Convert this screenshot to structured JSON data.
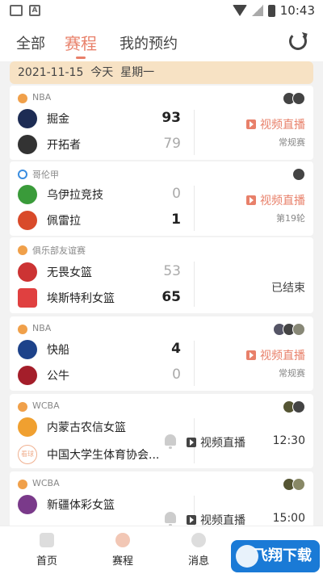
{
  "status": {
    "time": "10:43"
  },
  "nav": {
    "tabs": [
      "全部",
      "赛程",
      "我的预约"
    ]
  },
  "date_header": "2021-11-15  今天  星期一",
  "matches": [
    {
      "league": "NBA",
      "league_kind": "basketball",
      "home": "掘金",
      "away": "开拓者",
      "home_score": "93",
      "away_score": "79",
      "action": "视频直播",
      "stage": "常规赛"
    },
    {
      "league": "哥伦甲",
      "league_kind": "football",
      "home": "乌伊拉竞技",
      "away": "佩雷拉",
      "home_score": "0",
      "away_score": "1",
      "action": "视频直播",
      "stage": "第19轮"
    },
    {
      "league": "俱乐部友谊赛",
      "league_kind": "basketball",
      "home": "无畏女篮",
      "away": "埃斯特利女篮",
      "home_score": "53",
      "away_score": "65",
      "status": "已结束"
    },
    {
      "league": "NBA",
      "league_kind": "basketball",
      "home": "快船",
      "away": "公牛",
      "home_score": "4",
      "away_score": "0",
      "action": "视频直播",
      "stage": "常规赛"
    },
    {
      "league": "WCBA",
      "league_kind": "basketball",
      "home": "内蒙古农信女篮",
      "away": "中国大学生体育协会...",
      "away_logo_text": "看球",
      "action": "视频直播",
      "time": "12:30"
    },
    {
      "league": "WCBA",
      "league_kind": "basketball",
      "home": "新疆体彩女篮",
      "away": "",
      "action": "视频直播",
      "time": "15:00"
    }
  ],
  "bottom_nav": [
    "首页",
    "赛程",
    "消息",
    ""
  ],
  "watermark": "飞翔下载",
  "colors": {
    "accent": "#e8806a",
    "date_bg": "#f7e2c4"
  }
}
